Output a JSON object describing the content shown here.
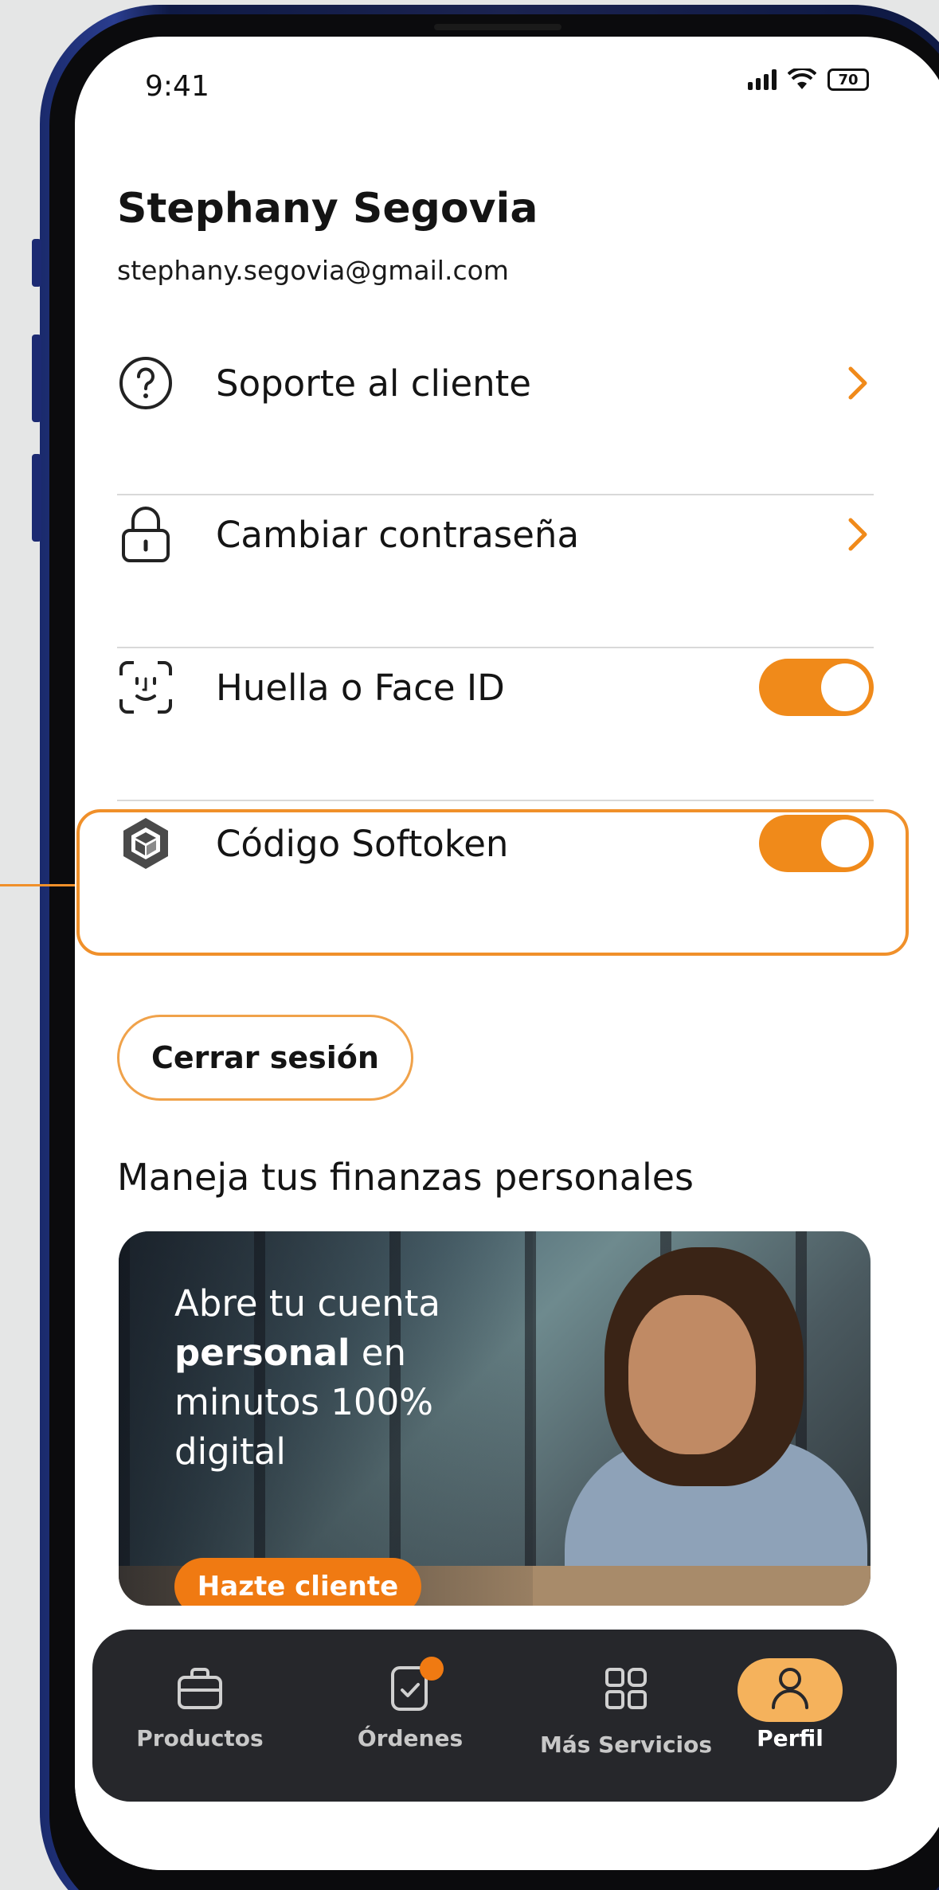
{
  "status_bar": {
    "time": "9:41",
    "battery": "70"
  },
  "profile": {
    "name": "Stephany Segovia",
    "email": "stephany.segovia@gmail.com"
  },
  "menu": [
    {
      "label": "Soporte al cliente",
      "icon": "question-circle-icon",
      "control": "chevron"
    },
    {
      "label": "Cambiar contraseña",
      "icon": "lock-icon",
      "control": "chevron"
    },
    {
      "label": "Huella o Face ID",
      "icon": "face-id-icon",
      "control": "toggle",
      "enabled": true
    },
    {
      "label": "Código Softoken",
      "icon": "softoken-cube-icon",
      "control": "toggle",
      "enabled": true
    }
  ],
  "logout_label": "Cerrar sesión",
  "section_title": "Maneja tus finanzas personales",
  "banner": {
    "line1": "Abre tu cuenta",
    "line2_bold": "personal",
    "line2_rest": " en",
    "line3": "minutos 100%",
    "line4": "digital",
    "cta_label": "Hazte cliente"
  },
  "bottom_nav": [
    {
      "label": "Productos",
      "icon": "briefcase-icon",
      "active": false
    },
    {
      "label": "Órdenes",
      "icon": "orders-icon",
      "active": false,
      "badge": true
    },
    {
      "label": "Más Servicios",
      "icon": "grid-icon",
      "active": false
    },
    {
      "label": "Perfil",
      "icon": "user-icon",
      "active": true
    }
  ],
  "colors": {
    "accent": "#f08a1a",
    "nav_bg": "#26272b",
    "active_pill": "#f5b25c"
  }
}
